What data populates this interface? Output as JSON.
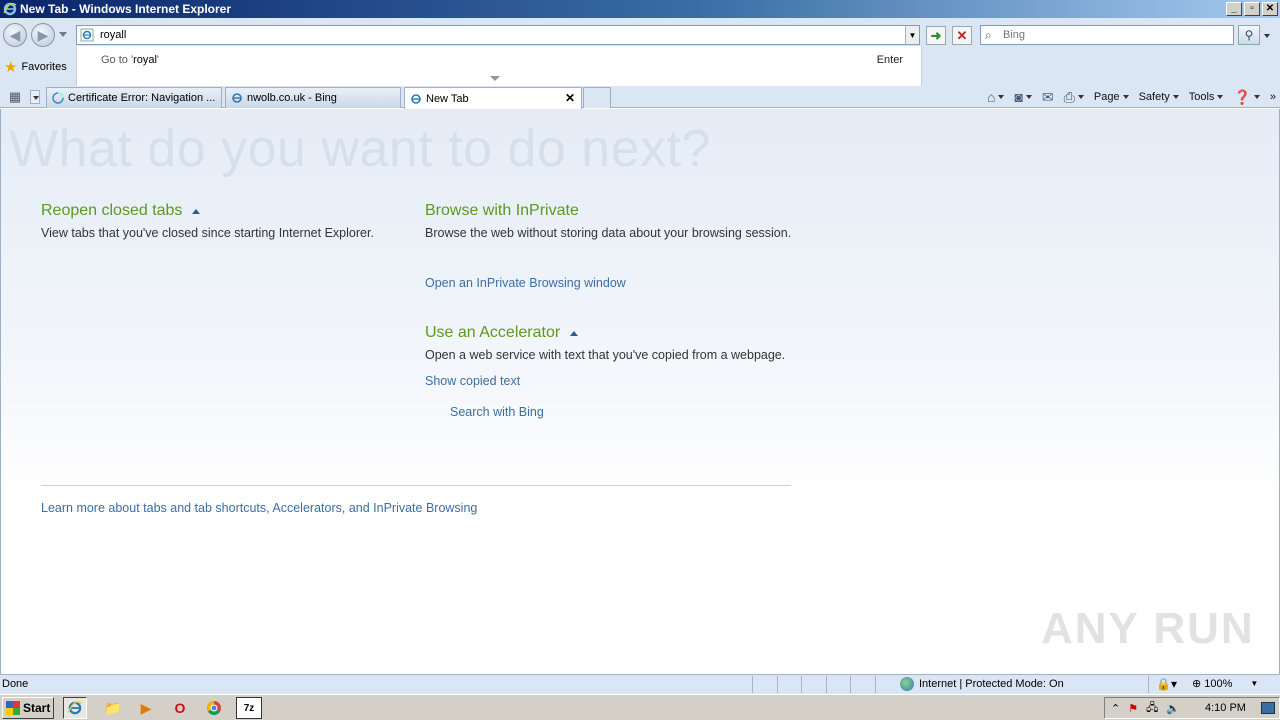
{
  "window": {
    "title": "New Tab - Windows Internet Explorer"
  },
  "address_bar": {
    "value": "royall"
  },
  "search_box": {
    "placeholder": "Bing"
  },
  "favorites": {
    "label": "Favorites"
  },
  "autocomplete": {
    "goto_prefix": "Go to '",
    "goto_value": "royal",
    "goto_suffix": "'",
    "enter_label": "Enter"
  },
  "tabs": [
    {
      "label": "Certificate Error: Navigation ...",
      "active": false
    },
    {
      "label": "nwolb.co.uk - Bing",
      "active": false
    },
    {
      "label": "New Tab",
      "active": true
    }
  ],
  "command_bar": {
    "page": "Page",
    "safety": "Safety",
    "tools": "Tools"
  },
  "content": {
    "hero": "What do you want to do next?",
    "reopen": {
      "heading": "Reopen closed tabs",
      "text": "View tabs that you've closed since starting Internet Explorer."
    },
    "inprivate": {
      "heading": "Browse with InPrivate",
      "text": "Browse the web without storing data about your browsing session.",
      "link": "Open an InPrivate Browsing window"
    },
    "accelerator": {
      "heading": "Use an Accelerator",
      "text": "Open a web service with text that you've copied from a webpage.",
      "link1": "Show copied text",
      "link2": "Search with Bing"
    },
    "learn_more": "Learn more about tabs and tab shortcuts, Accelerators, and InPrivate Browsing",
    "watermark": "ANY RUN"
  },
  "status_bar": {
    "status": "Done",
    "zone": "Internet | Protected Mode: On",
    "zoom": "100%"
  },
  "taskbar": {
    "start": "Start",
    "clock": "4:10 PM"
  }
}
